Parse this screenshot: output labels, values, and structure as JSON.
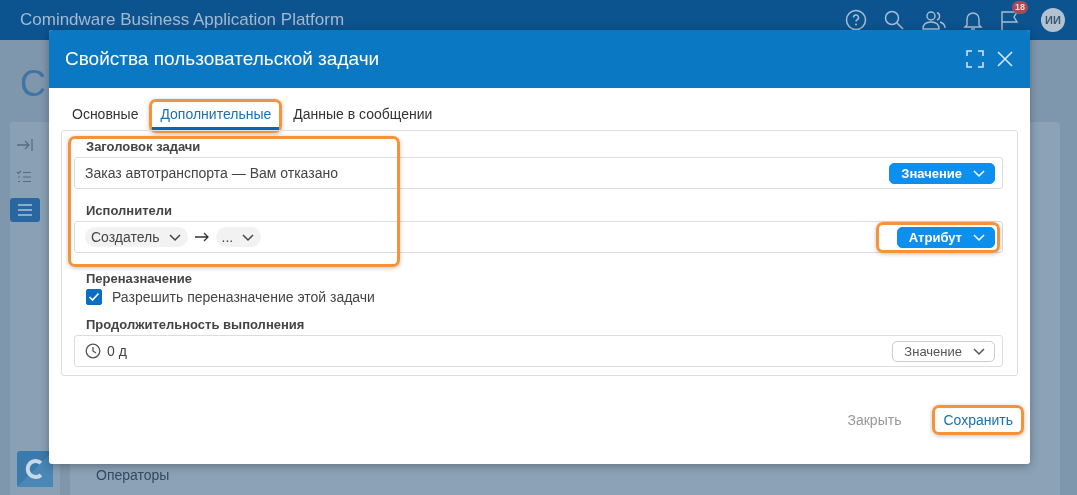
{
  "app_bar": {
    "title": "Comindware Business Application Platform",
    "notification_count": "18",
    "avatar": "ИИ"
  },
  "background": {
    "page_title": "C",
    "list_item": "Операторы"
  },
  "dialog": {
    "title": "Свойства пользовательской задачи",
    "tabs": [
      {
        "label": "Основные",
        "selected": false,
        "highlighted": false
      },
      {
        "label": "Дополнительные",
        "selected": true,
        "highlighted": true
      },
      {
        "label": "Данные в сообщении",
        "selected": false,
        "highlighted": false
      }
    ],
    "fields": [
      {
        "kind": "text",
        "label": "Заголовок задачи",
        "value": "Заказ автотранспорта — Вам отказано",
        "highlighted": true,
        "mode": {
          "label": "Значение",
          "kind": "filled",
          "highlighted": false
        }
      },
      {
        "kind": "chain",
        "label": "Исполнители",
        "chips": [
          "Создатель",
          "..."
        ],
        "highlighted": true,
        "mode": {
          "label": "Атрибут",
          "kind": "filled",
          "highlighted": true
        }
      },
      {
        "kind": "checkbox",
        "label": "Переназначение",
        "option": "Разрешить переназначение этой задачи",
        "checked": true,
        "highlighted": false
      },
      {
        "kind": "duration",
        "label": "Продолжительность выполнения",
        "value": "0 д",
        "highlighted": false,
        "mode": {
          "label": "Значение",
          "kind": "outline",
          "highlighted": false
        }
      }
    ],
    "buttons": [
      {
        "label": "Закрыть",
        "kind": "secondary",
        "highlighted": false
      },
      {
        "label": "Сохранить",
        "kind": "primary",
        "highlighted": true
      }
    ]
  }
}
